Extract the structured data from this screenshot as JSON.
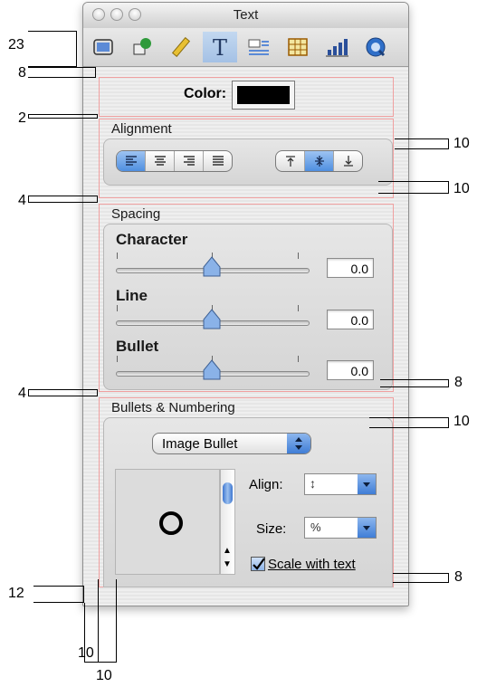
{
  "window": {
    "title": "Text"
  },
  "toolbar": {
    "items": [
      {
        "name": "document-inspector-icon",
        "selected": false
      },
      {
        "name": "graphics-inspector-icon",
        "selected": false
      },
      {
        "name": "metrics-inspector-icon",
        "selected": false
      },
      {
        "name": "text-inspector-icon",
        "selected": true
      },
      {
        "name": "wrap-inspector-icon",
        "selected": false
      },
      {
        "name": "table-inspector-icon",
        "selected": false
      },
      {
        "name": "chart-inspector-icon",
        "selected": false
      },
      {
        "name": "quicktime-inspector-icon",
        "selected": false
      }
    ]
  },
  "color": {
    "label": "Color:",
    "value": "#000000"
  },
  "alignment": {
    "label": "Alignment",
    "horizontal": [
      "align-left-icon",
      "align-center-icon",
      "align-right-icon",
      "align-justify-icon"
    ],
    "horizontal_selected": 0,
    "vertical": [
      "align-top-icon",
      "align-middle-icon",
      "align-bottom-icon"
    ],
    "vertical_selected": 1
  },
  "spacing": {
    "label": "Spacing",
    "character": {
      "label": "Character",
      "value": "0.0"
    },
    "line": {
      "label": "Line",
      "value": "0.0"
    },
    "bullet": {
      "label": "Bullet",
      "value": "0.0"
    }
  },
  "bullets": {
    "label": "Bullets & Numbering",
    "type": "Image Bullet",
    "align_label": "Align:",
    "align_value": "↕",
    "size_label": "Size:",
    "size_value": "%",
    "scale_label": "Scale with text",
    "scale_checked": true
  },
  "annotations": {
    "toolbar_height": "23",
    "top_gap": "8",
    "section_gap_2": "2",
    "group_pad_top": "10",
    "group_pad_bottom": "10",
    "section_gap_4a": "4",
    "field_right_gap": "8",
    "section_gap_4b": "4",
    "group_pad_top_2": "10",
    "bottom_gap": "8",
    "left_margin": "12",
    "inner_left_1": "10",
    "inner_left_2": "10"
  }
}
